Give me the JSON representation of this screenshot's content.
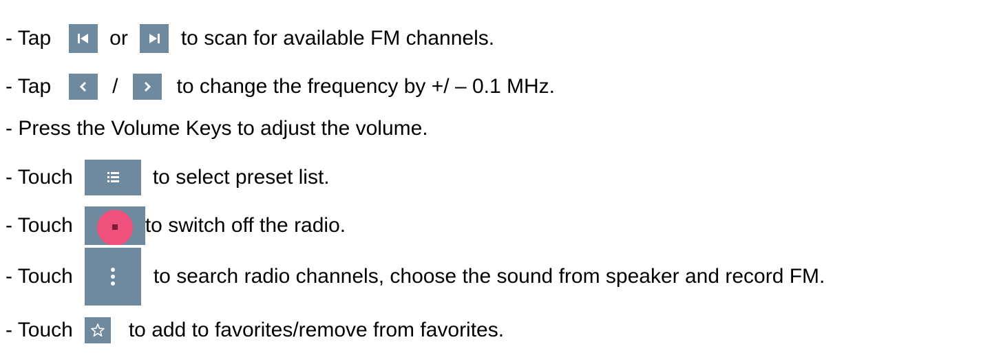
{
  "colors": {
    "tile": "#6f8a9e",
    "glyph": "#ffffff",
    "stop_circle": "#f0507c",
    "stop_square": "#7a1d36"
  },
  "instructions": {
    "scan": {
      "prefix": "- Tap",
      "icon_prev": "skip-previous-icon",
      "middle": "or",
      "icon_next": "skip-next-icon",
      "suffix": "to scan for available FM channels."
    },
    "tune": {
      "prefix": "- Tap",
      "icon_left": "chevron-left-icon",
      "middle": "/",
      "icon_right": "chevron-right-icon",
      "suffix": "to change the frequency by +/ – 0.1 MHz."
    },
    "volume": {
      "text": "- Press the Volume Keys to adjust the volume."
    },
    "preset": {
      "prefix": "- Touch",
      "icon": "list-icon",
      "suffix": "to select preset list."
    },
    "power": {
      "prefix": "- Touch",
      "icon": "stop-icon",
      "suffix": "to switch off the radio."
    },
    "menu": {
      "prefix": "- Touch",
      "icon": "more-vertical-icon",
      "suffix": "to search radio channels, choose the sound from speaker and record FM."
    },
    "favorite": {
      "prefix": "- Touch",
      "icon": "star-outline-icon",
      "suffix": "to add to favorites/remove from favorites."
    }
  }
}
